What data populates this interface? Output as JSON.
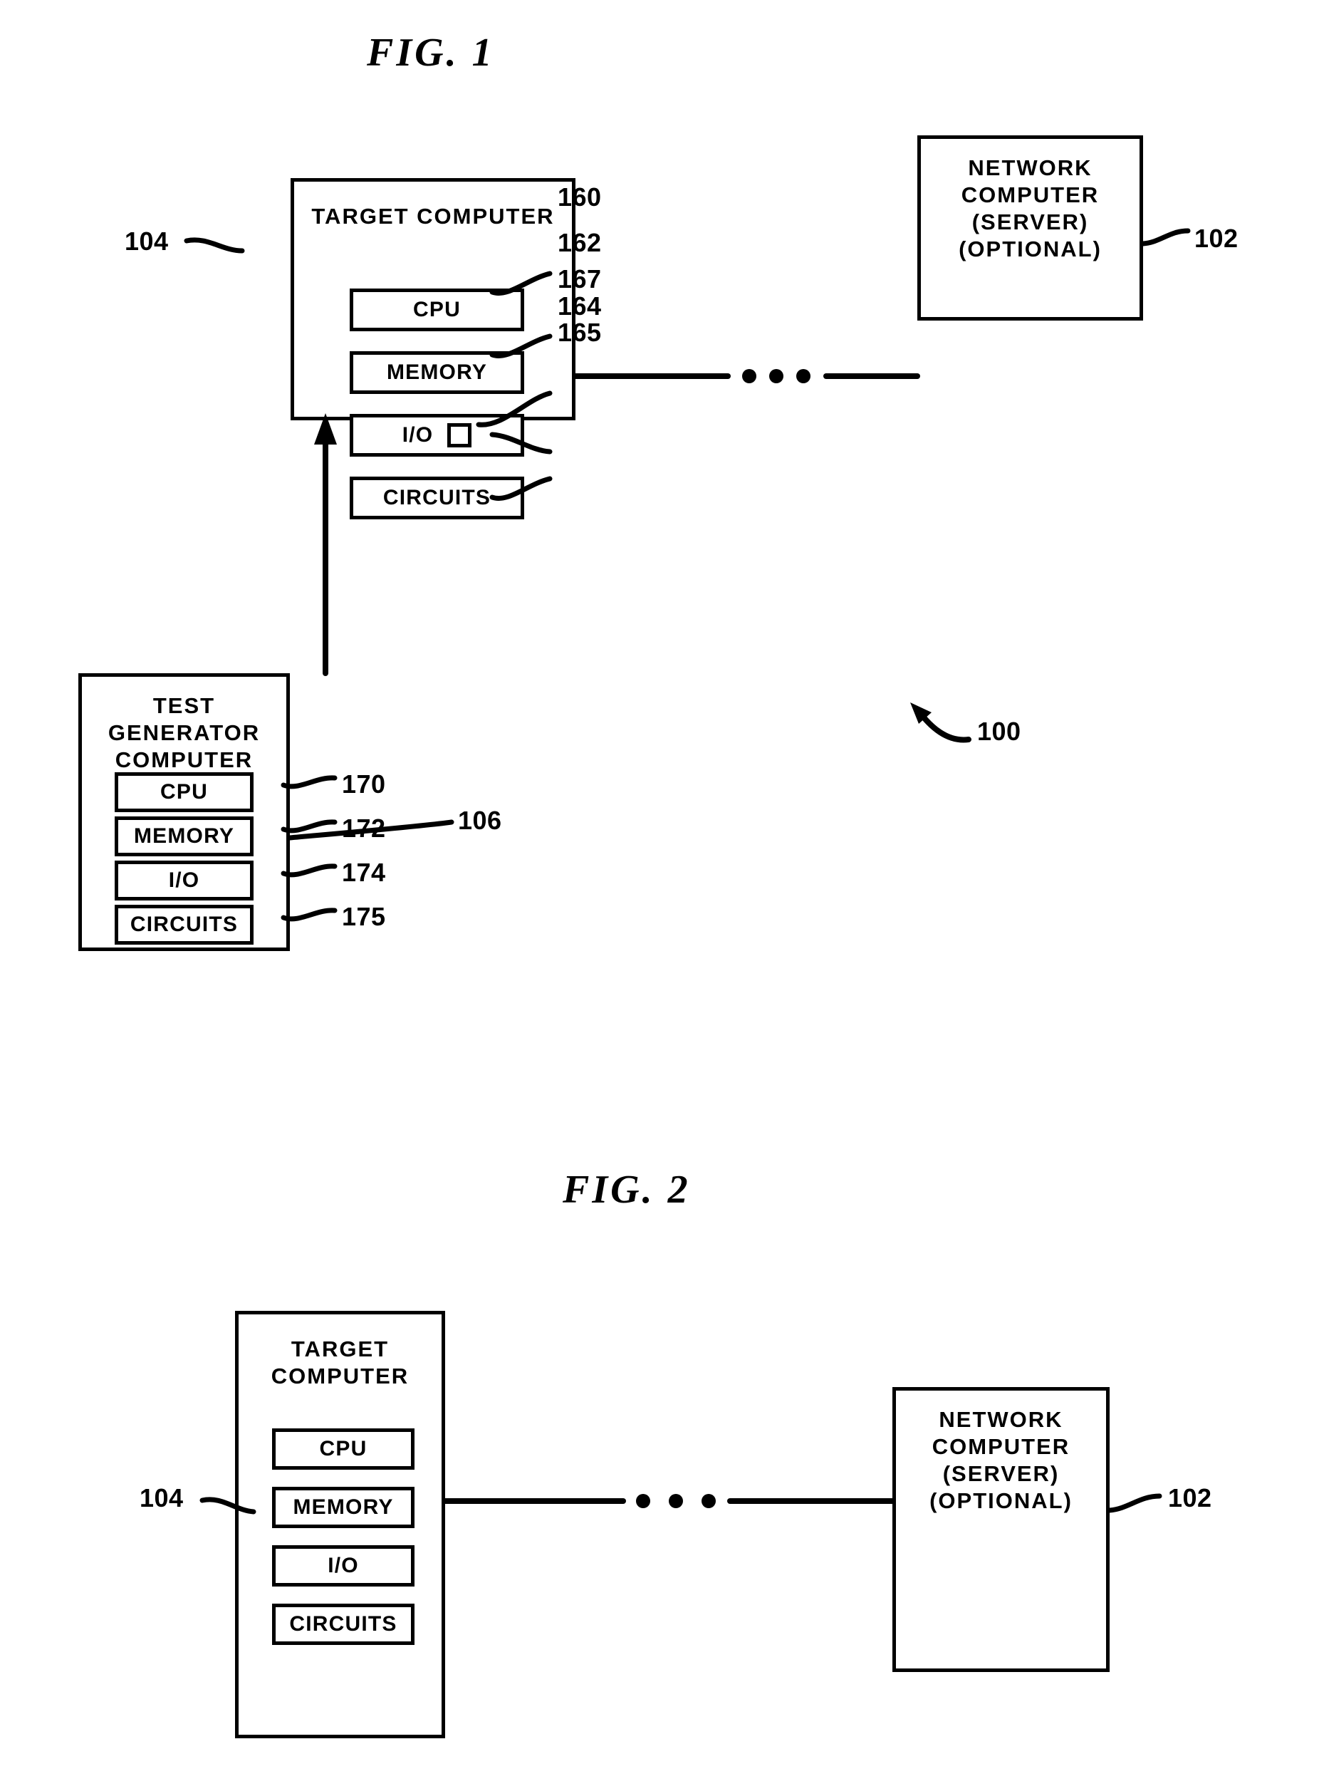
{
  "page": {
    "background_color": "#ffffff",
    "ink_color": "#000000"
  },
  "figures": [
    {
      "id": "fig1",
      "title": "FIG.  1",
      "system_ref": "100",
      "nodes": {
        "target_computer": {
          "title": "TARGET COMPUTER",
          "ref": "104",
          "components": [
            {
              "label": "CPU",
              "ref": "160"
            },
            {
              "label": "MEMORY",
              "ref": "162"
            },
            {
              "label": "I/O",
              "ref": "164",
              "sub_ref": "167",
              "has_square": true
            },
            {
              "label": "CIRCUITS",
              "ref": "165"
            }
          ]
        },
        "network_computer": {
          "title": "NETWORK\nCOMPUTER\n(SERVER)\n(OPTIONAL)",
          "ref": "102"
        },
        "test_generator_computer": {
          "title": "TEST GENERATOR\nCOMPUTER",
          "ref": "106",
          "components": [
            {
              "label": "CPU",
              "ref": "170"
            },
            {
              "label": "MEMORY",
              "ref": "172"
            },
            {
              "label": "I/O",
              "ref": "174"
            },
            {
              "label": "CIRCUITS",
              "ref": "175"
            }
          ]
        }
      },
      "connections": [
        {
          "from": "target_computer",
          "to": "network_computer",
          "style": "dashed-ellipsis"
        },
        {
          "from": "test_generator_computer",
          "to": "target_computer",
          "style": "arrow-up"
        }
      ]
    },
    {
      "id": "fig2",
      "title": "FIG.  2",
      "nodes": {
        "target_computer": {
          "title": "TARGET COMPUTER",
          "ref": "104",
          "components": [
            {
              "label": "CPU"
            },
            {
              "label": "MEMORY"
            },
            {
              "label": "I/O"
            },
            {
              "label": "CIRCUITS"
            }
          ]
        },
        "network_computer": {
          "title": "NETWORK\nCOMPUTER\n(SERVER)\n(OPTIONAL)",
          "ref": "102"
        }
      },
      "connections": [
        {
          "from": "target_computer",
          "to": "network_computer",
          "style": "dashed-ellipsis"
        }
      ]
    }
  ]
}
